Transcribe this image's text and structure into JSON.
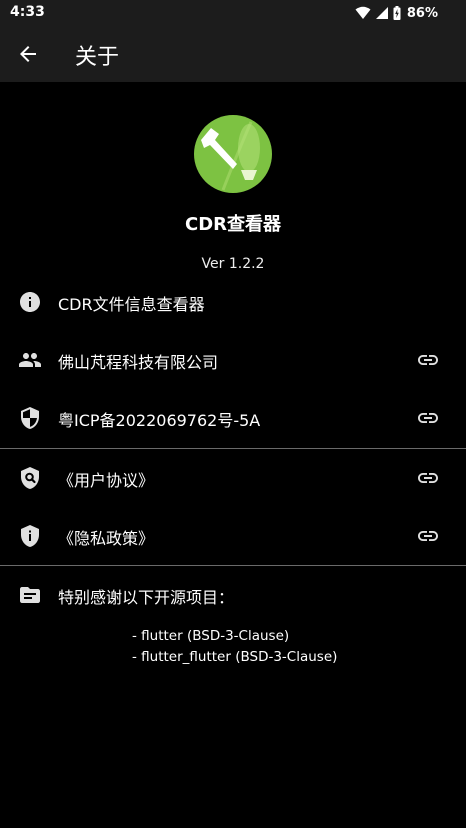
{
  "status_bar": {
    "time": "4:33",
    "battery": "86%"
  },
  "app_bar": {
    "title": "关于"
  },
  "app": {
    "name": "CDR查看器",
    "version": "Ver 1.2.2"
  },
  "rows": [
    {
      "label": "CDR文件信息查看器",
      "icon": "info-icon"
    },
    {
      "label": "佛山芃程科技有限公司",
      "icon": "people-icon",
      "link": true
    },
    {
      "label": "粤ICP备2022069762号-5A",
      "icon": "shield-icon",
      "link": true
    },
    {
      "label": "《用户协议》",
      "icon": "search-shield-icon",
      "link": true
    },
    {
      "label": "《隐私政策》",
      "icon": "privacy-shield-icon",
      "link": true
    },
    {
      "label": "特别感谢以下开源项目：",
      "icon": "folder-icon"
    }
  ],
  "open_source": [
    "- flutter (BSD-3-Clause)",
    "- flutter_flutter (BSD-3-Clause)"
  ],
  "colors": {
    "background": "#000000",
    "bar": "#1c1c1c",
    "icon": "#e0e0e0",
    "logo_green": "#7dc242"
  }
}
